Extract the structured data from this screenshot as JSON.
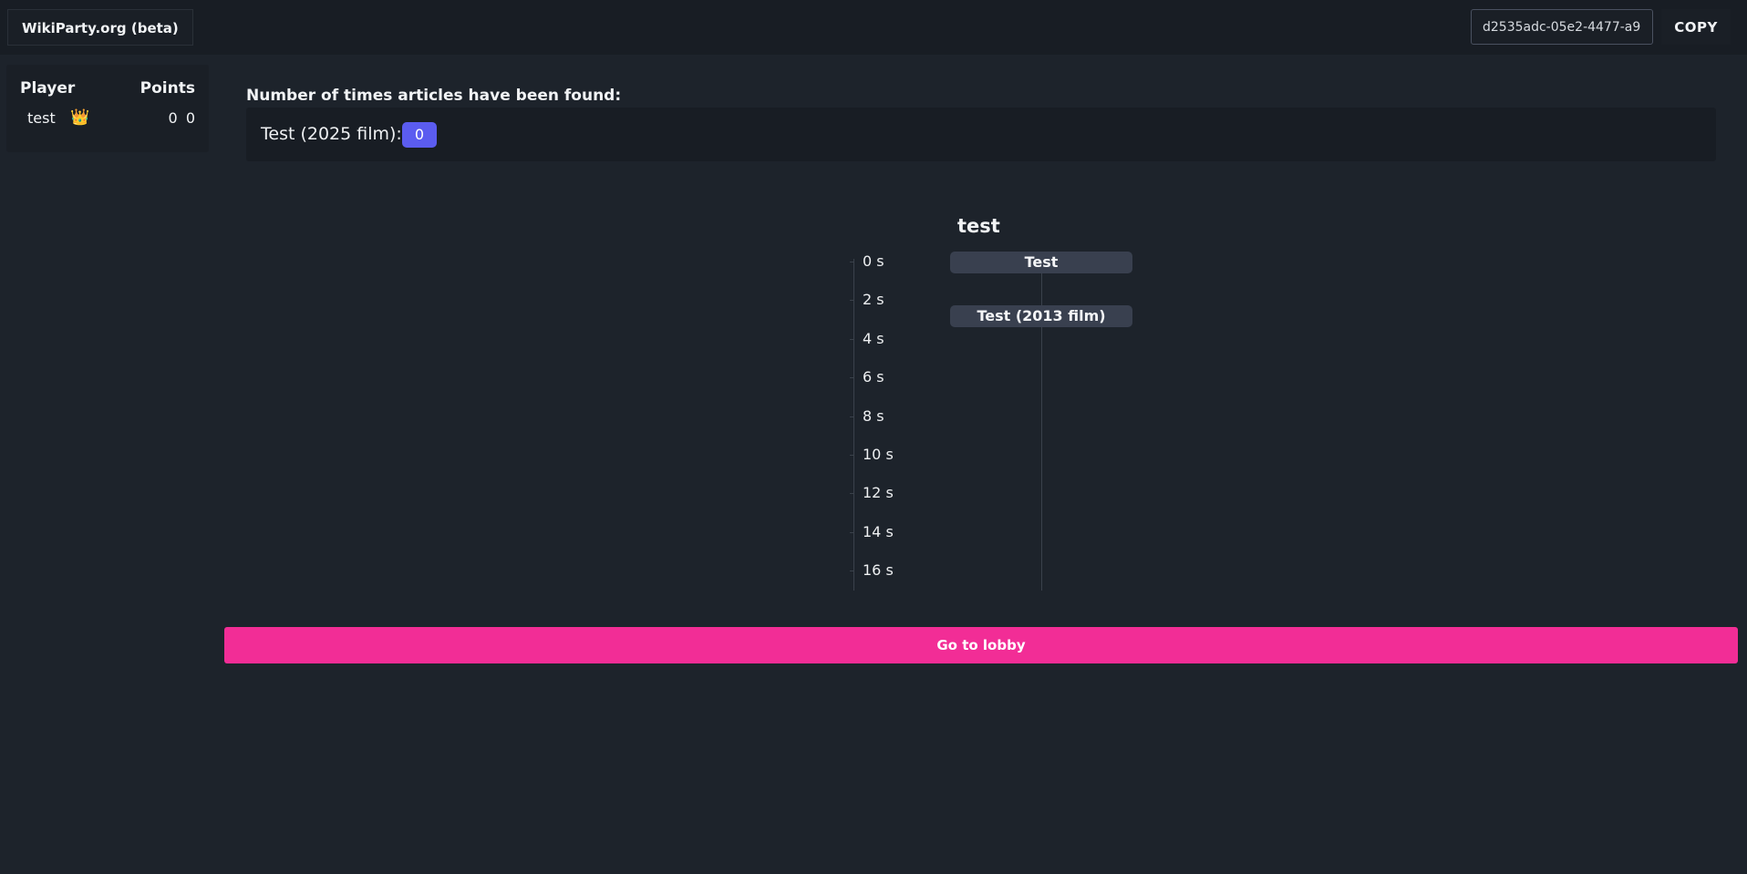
{
  "header": {
    "brand": "WikiParty.org (beta)",
    "game_id": "d2535adc-05e2-4477-a9",
    "copy_label": "COPY"
  },
  "scoreboard": {
    "col_player": "Player",
    "col_points": "Points",
    "rows": [
      {
        "name": "test",
        "badge_icon": "crown-icon",
        "badge_glyph": "👑",
        "points": "0",
        "total": "0"
      }
    ]
  },
  "found": {
    "title": "Number of times articles have been found:",
    "items": [
      {
        "label": "Test (2025 film):",
        "count": "0"
      }
    ]
  },
  "timeline": {
    "player": "test",
    "ticks": [
      "0 s",
      "2 s",
      "4 s",
      "6 s",
      "8 s",
      "10 s",
      "12 s",
      "14 s",
      "16 s"
    ],
    "articles": [
      {
        "title": "Test",
        "time_s": 0
      },
      {
        "title": "Test (2013 film)",
        "time_s": 2.8
      }
    ]
  },
  "actions": {
    "lobby_label": "Go to lobby"
  },
  "colors": {
    "background": "#1d232b",
    "accent_pink": "#f22d96",
    "badge_purple": "#5b5cf0"
  }
}
